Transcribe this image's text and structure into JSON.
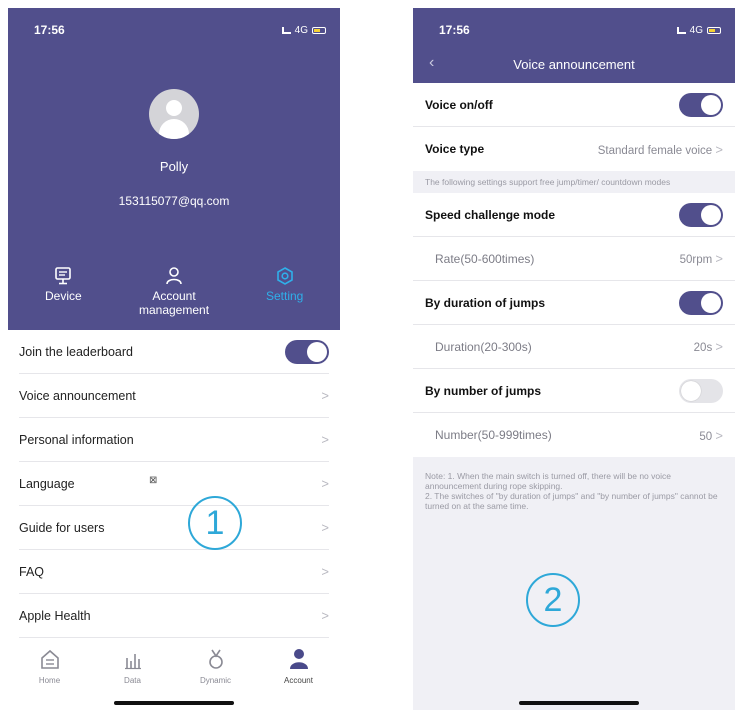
{
  "screen1": {
    "status": {
      "time": "17:56",
      "network": "4G"
    },
    "profile": {
      "name": "Polly",
      "email": "153115077@qq.com"
    },
    "tabs": [
      {
        "label": "Device",
        "icon": "monitor-icon"
      },
      {
        "label": "Account management",
        "icon": "person-icon"
      },
      {
        "label": "Setting",
        "icon": "gear-icon",
        "active": true
      }
    ],
    "settings": [
      {
        "label": "Join the leaderboard",
        "toggle": true
      },
      {
        "label": "Voice announcement"
      },
      {
        "label": "Personal information"
      },
      {
        "label": "Language",
        "extra": "⊠"
      },
      {
        "label": "Guide for users"
      },
      {
        "label": "FAQ"
      },
      {
        "label": "Apple Health"
      }
    ],
    "callout": "1",
    "tabbar": [
      {
        "label": "Home",
        "icon": "home-icon"
      },
      {
        "label": "Data",
        "icon": "bar-chart-icon"
      },
      {
        "label": "Dynamic",
        "icon": "medal-icon"
      },
      {
        "label": "Account",
        "icon": "person-icon",
        "active": true
      }
    ]
  },
  "screen2": {
    "status": {
      "time": "17:56",
      "network": "4G"
    },
    "title": "Voice announcement",
    "voice_onoff": {
      "label": "Voice on/off",
      "on": true
    },
    "voice_type": {
      "label": "Voice type",
      "value": "Standard female voice"
    },
    "section_note": "The following settings support free jump/timer/ countdown modes",
    "speed_mode": {
      "label": "Speed challenge mode",
      "on": true
    },
    "rate": {
      "label": "Rate(50-600times)",
      "value": "50rpm"
    },
    "duration_mode": {
      "label": "By duration of jumps",
      "on": true
    },
    "duration": {
      "label": "Duration(20-300s)",
      "value": "20s"
    },
    "number_mode": {
      "label": "By number of jumps",
      "on": false
    },
    "number": {
      "label": "Number(50-999times)",
      "value": "50"
    },
    "footnote_1": "Note: 1. When the main switch is turned off, there will be no voice announcement during rope skipping.",
    "footnote_2": "2. The switches of \"by duration of jumps\" and \"by number of jumps\" cannot be turned on at the same time.",
    "callout": "2"
  },
  "chevron": ">",
  "colors": {
    "primary": "#514f8c",
    "accent": "#2fb0ea",
    "callout": "#2ea8d8"
  }
}
